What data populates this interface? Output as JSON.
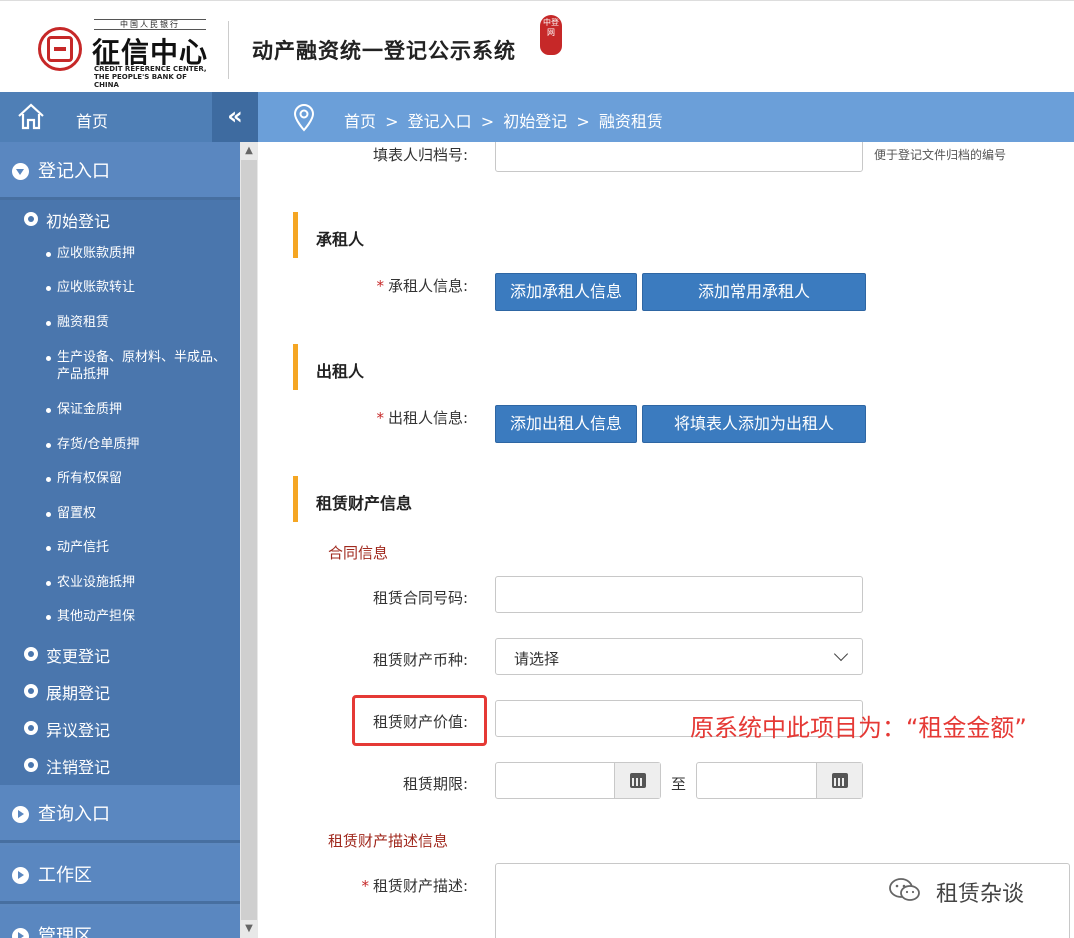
{
  "header": {
    "logo_top": "中国人民银行",
    "logo_main": "征信中心",
    "logo_sub": "CREDIT REFERENCE CENTER, THE PEOPLE'S BANK OF CHINA",
    "system_title": "动产融资统一登记公示系统",
    "stamp_text": "中登网"
  },
  "nav": {
    "home_label": "首页",
    "collapse_glyph": "«",
    "breadcrumb": [
      "首页",
      ">",
      "登记入口",
      ">",
      "初始登记",
      ">",
      "融资租赁"
    ]
  },
  "sidebar": {
    "sections": [
      {
        "label": "登记入口",
        "expanded": true
      },
      {
        "label": "查询入口",
        "expanded": false
      },
      {
        "label": "工作区",
        "expanded": false
      },
      {
        "label": "管理区",
        "expanded": false
      }
    ],
    "registration_items": [
      {
        "label": "初始登记"
      },
      {
        "label": "变更登记"
      },
      {
        "label": "展期登记"
      },
      {
        "label": "异议登记"
      },
      {
        "label": "注销登记"
      }
    ],
    "initial_sub_items": [
      "应收账款质押",
      "应收账款转让",
      "融资租赁",
      "生产设备、原材料、半成品、产品抵押",
      "保证金质押",
      "存货/仓单质押",
      "所有权保留",
      "留置权",
      "动产信托",
      "农业设施抵押",
      "其他动产担保"
    ]
  },
  "form": {
    "archive_label": "填表人归档号:",
    "archive_hint": "便于登记文件归档的编号",
    "lessee_section": "承租人",
    "lessee_label": "承租人信息:",
    "lessee_add_button": "添加承租人信息",
    "lessee_common_button": "添加常用承租人",
    "lessor_section": "出租人",
    "lessor_label": "出租人信息:",
    "lessor_add_button": "添加出租人信息",
    "lessor_self_button": "将填表人添加为出租人",
    "property_section": "租赁财产信息",
    "contract_subtitle": "合同信息",
    "contract_no_label": "租赁合同号码:",
    "currency_label": "租赁财产币种:",
    "currency_value": "请选择",
    "value_label": "租赁财产价值:",
    "term_label": "租赁期限:",
    "term_to": "至",
    "desc_subtitle": "租赁财产描述信息",
    "desc_label": "租赁财产描述:",
    "required_mark": "*"
  },
  "annotation": {
    "text": "原系统中此项目为：“租金金额”",
    "color": "#e53935"
  },
  "watermark": {
    "text": "租赁杂谈"
  },
  "colors": {
    "sidebar": "#5c88bf",
    "breadcrumb_bar": "#6b9fd9",
    "button": "#3b7bbf",
    "section_accent": "#f5a623",
    "required": "#c62828"
  }
}
